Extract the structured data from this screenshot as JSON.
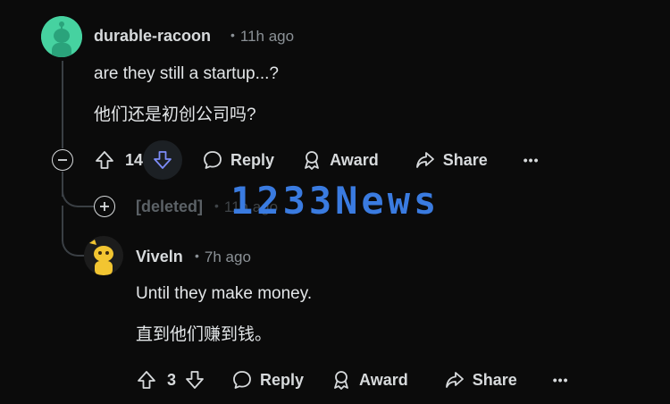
{
  "comment1": {
    "username": "durable-racoon",
    "time": "11h ago",
    "body_en": "are they still a startup...?",
    "body_zh": "他们还是初创公司吗?",
    "votes": "14",
    "reply_label": "Reply",
    "award_label": "Award",
    "share_label": "Share",
    "more_label": "•••"
  },
  "deleted": {
    "username": "[deleted]",
    "time": "11h ago"
  },
  "comment2": {
    "username": "Viveln",
    "time": "7h ago",
    "body_en": "Until they make money.",
    "body_zh": "直到他们赚到钱。",
    "votes": "3",
    "reply_label": "Reply",
    "award_label": "Award",
    "share_label": "Share",
    "more_label": "•••"
  },
  "watermark": "1233News",
  "colors": {
    "background": "#0b0b0b",
    "text": "#d7dadc",
    "meta": "#8b9196",
    "downvote_active": "#7c8cf8",
    "watermark": "#3a7be0",
    "avatar1": "#46d2a0"
  },
  "icons": [
    "collapse-icon",
    "expand-icon",
    "upvote-icon",
    "downvote-icon",
    "reply-icon",
    "award-icon",
    "share-icon",
    "more-icon"
  ]
}
